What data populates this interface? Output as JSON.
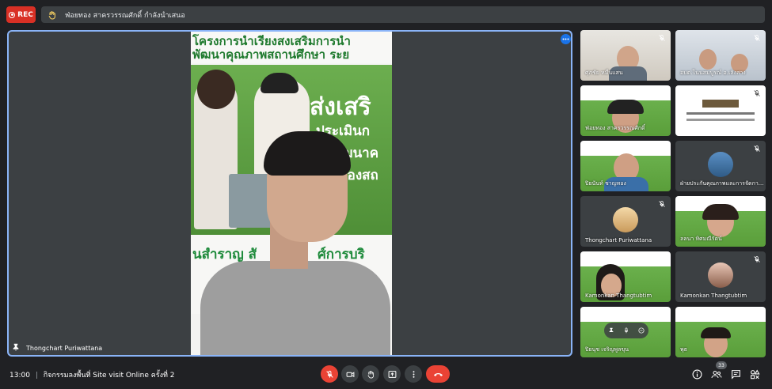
{
  "top": {
    "rec_label": "REC",
    "presenting_text": "ฟ่อยทอง สาครวรรณศักดิ์ กำลังนำเสนอ"
  },
  "stage": {
    "presenter_name": "Thongchart Puriwattana",
    "slide_line1": "โครงการนำเรียงสงเสริมการนำ",
    "slide_line2": "พัฒนาคุณภาพสถานศึกษา ระย",
    "slide_big": "ส่งเสริ",
    "slide_line3": "ประเมินก",
    "slide_line4": "พัฒนาค",
    "slide_line5": "ของสถ",
    "slide_bottom1": "นสำราญ สั",
    "slide_bottom2": "ศ์การบริ"
  },
  "tiles": [
    {
      "name": "ศุภชัย หมื่นแสน"
    },
    {
      "name": "อบต.โนนสมบูรณ์ อ.เลิงสาง"
    },
    {
      "name": "ฟ่อยทอง สาครวรรณศักดิ์"
    },
    {
      "name": ""
    },
    {
      "name": "ปิยนันท์ ชาญทอง"
    },
    {
      "name": "ฝ่ายประกันคุณภาพและการจัดกา..."
    },
    {
      "name": "Thongchart Puriwattana"
    },
    {
      "name": "ลลนา ทิศมณีรัตน์"
    },
    {
      "name": "Kamonkan Thangtubtim"
    },
    {
      "name": "Kamonkan Thangtubtim"
    },
    {
      "name": "ปิยนุช เจริญพูลขุน"
    },
    {
      "name": "พุธ"
    }
  ],
  "bottom": {
    "time": "13:00",
    "separator": "|",
    "meeting_title": "กิจกรรมลงพื้นที่ Site visit Online ครั้งที่ 2",
    "participant_count": "33"
  },
  "colors": {
    "accent": "#8ab4f8",
    "rec": "#d93025",
    "danger": "#ea4335",
    "bar_bg": "#202124",
    "tile_bg": "#3c4043"
  }
}
